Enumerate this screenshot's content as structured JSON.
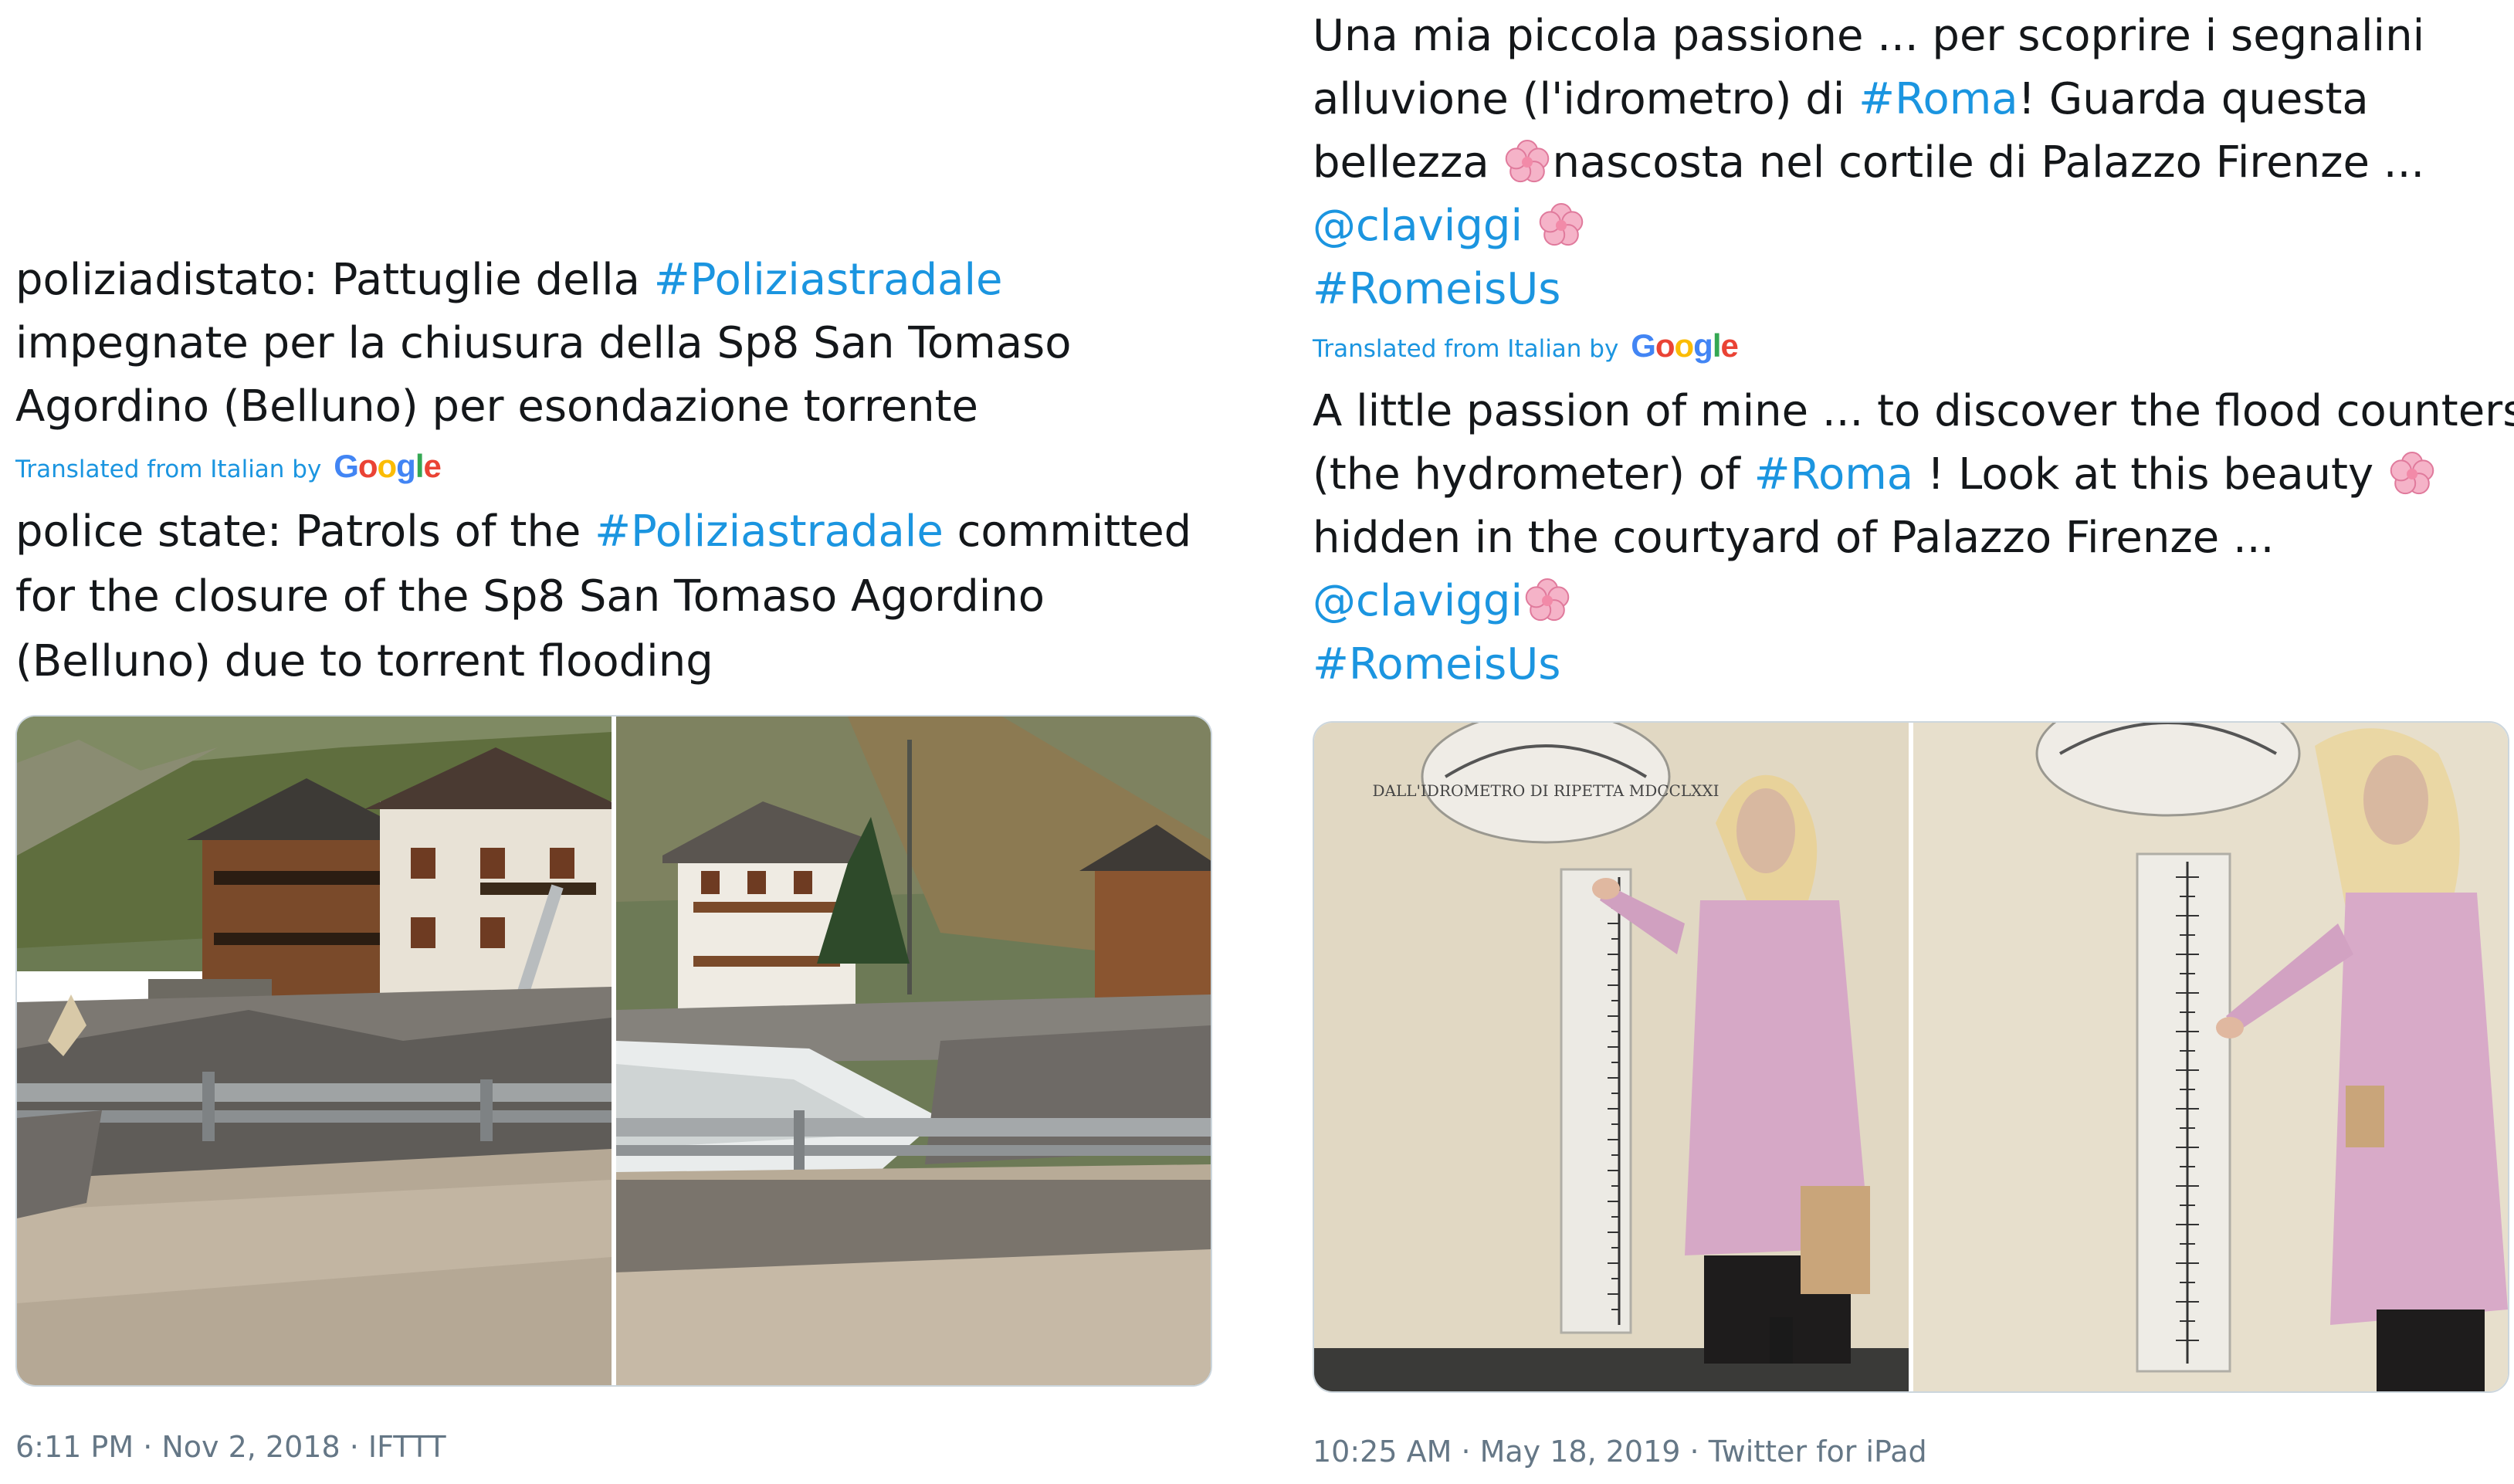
{
  "left_tweet": {
    "original_lines": [
      {
        "parts": [
          {
            "text": "poliziadistato: Pattuglie della ",
            "kind": "text"
          },
          {
            "text": "#Poliziastradale",
            "kind": "hashtag"
          }
        ]
      },
      {
        "parts": [
          {
            "text": "impegnate per la chiusura della Sp8 San Tomaso",
            "kind": "text"
          }
        ]
      },
      {
        "parts": [
          {
            "text": "Agordino (Belluno) per esondazione torrente",
            "kind": "text"
          }
        ]
      }
    ],
    "translated_label": "Translated from Italian by",
    "translator_logo": "Google",
    "translation_lines": [
      {
        "parts": [
          {
            "text": "police state: Patrols of the ",
            "kind": "text"
          },
          {
            "text": "#Poliziastradale",
            "kind": "hashtag"
          },
          {
            "text": " committed",
            "kind": "text"
          }
        ]
      },
      {
        "parts": [
          {
            "text": "for the closure of the Sp8 San Tomaso Agordino",
            "kind": "text"
          }
        ]
      },
      {
        "parts": [
          {
            "text": "(Belluno) due to torrent flooding",
            "kind": "text"
          }
        ]
      }
    ],
    "photos": [
      "flooded-road-with-houses-photo",
      "river-torrent-with-houses-photo"
    ],
    "meta": "6:11 PM · Nov 2, 2018 · IFTTT"
  },
  "right_tweet": {
    "original_lines": [
      {
        "parts": [
          {
            "text": "Una mia piccola passione ... per scoprire i segnalini",
            "kind": "text"
          }
        ]
      },
      {
        "parts": [
          {
            "text": "alluvione (l'idrometro) di ",
            "kind": "text"
          },
          {
            "text": "#Roma",
            "kind": "hashtag"
          },
          {
            "text": "!  Guarda questa",
            "kind": "text"
          }
        ]
      },
      {
        "parts": [
          {
            "text": "bellezza ",
            "kind": "text"
          },
          {
            "text": "cherry-blossom-emoji",
            "kind": "emoji"
          },
          {
            "text": "nascosta nel cortile di Palazzo Firenze ...",
            "kind": "text"
          }
        ]
      },
      {
        "parts": [
          {
            "text": "@claviggi",
            "kind": "mention"
          },
          {
            "text": "  ",
            "kind": "text"
          },
          {
            "text": "cherry-blossom-emoji",
            "kind": "emoji"
          }
        ]
      },
      {
        "parts": [
          {
            "text": "#RomeisUs",
            "kind": "hashtag"
          }
        ]
      }
    ],
    "translated_label": "Translated from Italian by",
    "translator_logo": "Google",
    "translation_lines": [
      {
        "parts": [
          {
            "text": "A little passion of mine ... to discover the flood counters",
            "kind": "text"
          }
        ]
      },
      {
        "parts": [
          {
            "text": "(the hydrometer) of ",
            "kind": "text"
          },
          {
            "text": "#Roma",
            "kind": "hashtag"
          },
          {
            "text": " ! Look at this beauty ",
            "kind": "text"
          },
          {
            "text": "cherry-blossom-emoji",
            "kind": "emoji"
          }
        ]
      },
      {
        "parts": [
          {
            "text": "hidden in the courtyard of Palazzo Firenze ...",
            "kind": "text"
          }
        ]
      },
      {
        "parts": [
          {
            "text": "@claviggi",
            "kind": "mention"
          },
          {
            "text": "cherry-blossom-emoji",
            "kind": "emoji"
          }
        ]
      },
      {
        "parts": [
          {
            "text": "#RomeisUs",
            "kind": "hashtag"
          }
        ]
      }
    ],
    "photos": [
      "woman-at-hydrometer-photo-1",
      "woman-at-hydrometer-photo-2"
    ],
    "plaque_text": "DALL'IDROMETRO DI RIPETTA MDCCLXXI",
    "meta": "10:25 AM · May 18, 2019 · Twitter for iPad"
  },
  "colors": {
    "link": "#1b95e0",
    "text": "#14171a",
    "meta": "#657786",
    "border": "#ccd6dd"
  }
}
